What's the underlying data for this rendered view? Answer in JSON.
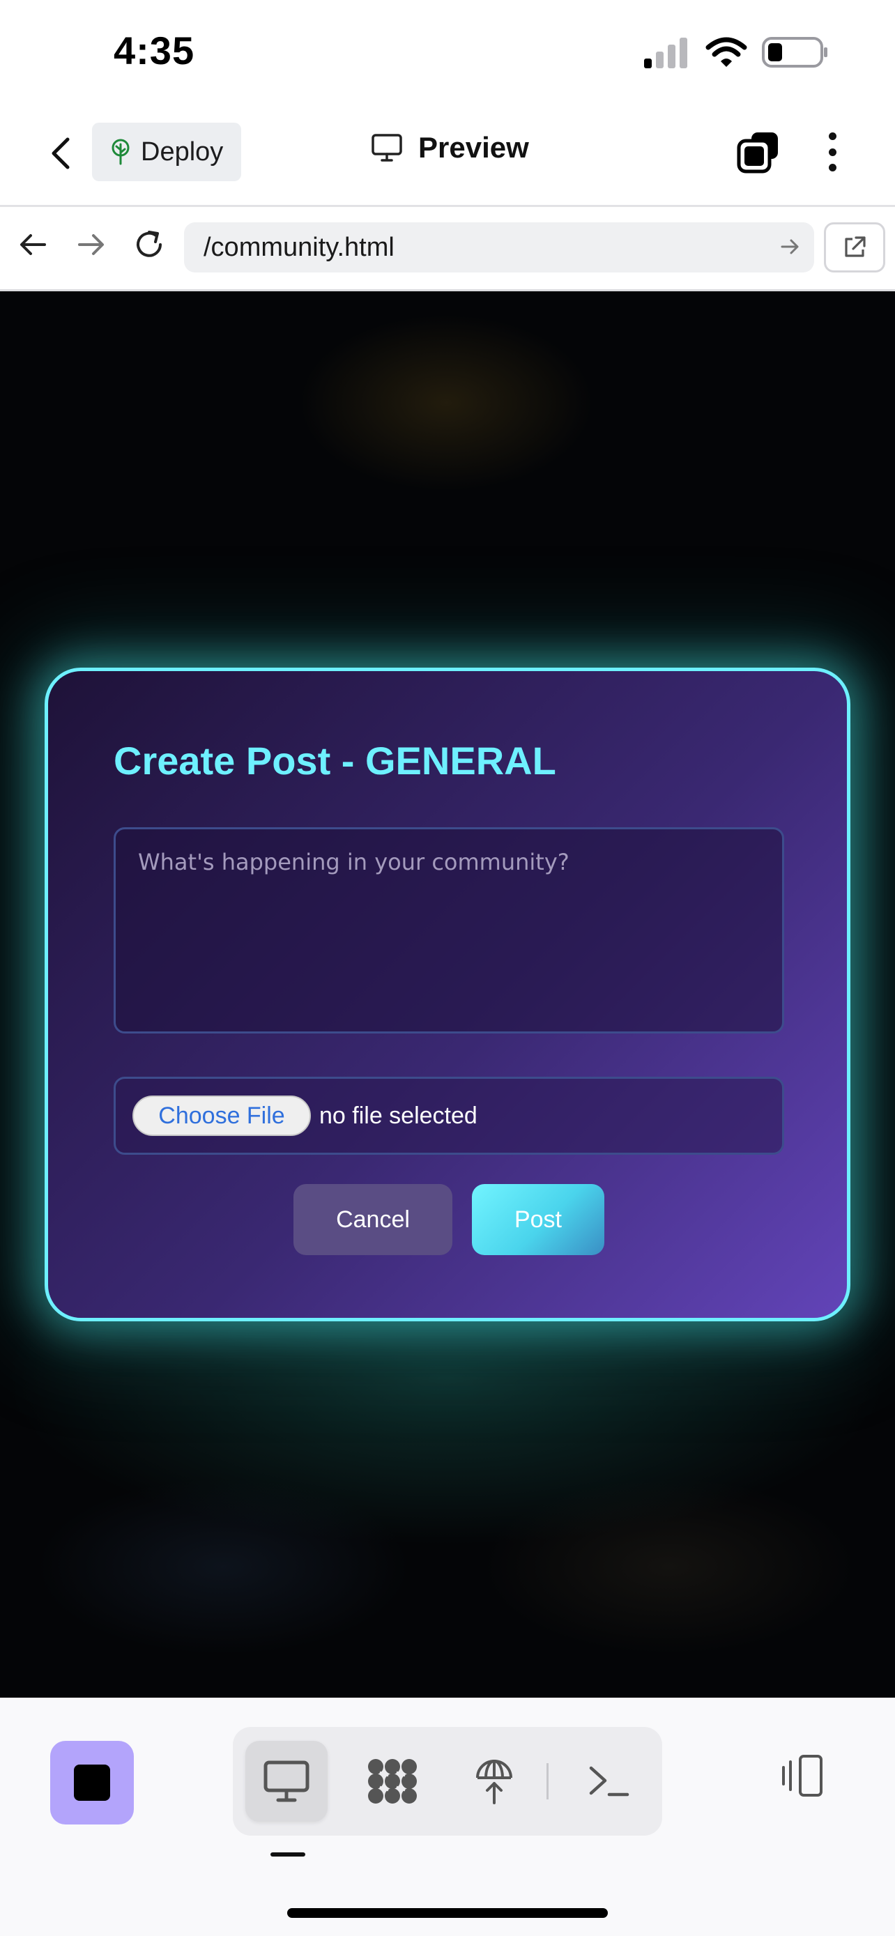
{
  "status_bar": {
    "time": "4:35",
    "icons": [
      "signal-icon",
      "wifi-icon",
      "battery-icon"
    ]
  },
  "header": {
    "back_icon": "chevron-left-icon",
    "deploy_label": "Deploy",
    "deploy_icon": "tree-icon",
    "title": "Preview",
    "title_icon": "monitor-icon",
    "tabs_icon": "tabs-icon",
    "more_icon": "more-vertical-icon"
  },
  "browser": {
    "url": "/community.html",
    "back_icon": "arrow-left-icon",
    "forward_icon": "arrow-right-icon",
    "reload_icon": "reload-icon",
    "go_icon": "arrow-right-icon",
    "external_icon": "external-link-icon"
  },
  "modal": {
    "title": "Create Post - GENERAL",
    "textarea_placeholder": "What's happening in your community?",
    "textarea_value": "",
    "choose_file_label": "Choose File",
    "file_status": "no file selected",
    "cancel_label": "Cancel",
    "post_label": "Post",
    "colors": {
      "accent": "#6ef0ff",
      "panel_start": "#1e1238",
      "panel_end": "#6244b8",
      "cancel_bg": "#5a4d84"
    }
  },
  "bottom_bar": {
    "stop_icon": "stop-icon",
    "modes": [
      "monitor-icon",
      "network-icon",
      "deploy-icon",
      "terminal-icon"
    ],
    "active_mode": "monitor-icon",
    "device_icon": "device-rotate-icon",
    "accent": "#b3a4fb"
  }
}
